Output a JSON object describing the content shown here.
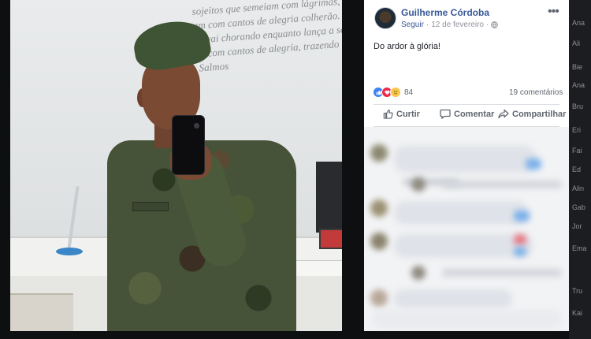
{
  "post": {
    "author": "Guilherme Córdoba",
    "follow": "Seguir",
    "separator": "·",
    "date": "12 de fevereiro",
    "menu": "•••",
    "caption": "Do ardor à glória!",
    "reaction_count": "84",
    "comments_count": "19 comentários",
    "actions": {
      "like": "Curtir",
      "comment": "Comentar",
      "share": "Compartilhar"
    }
  },
  "photo_wall_text": [
    "sojeitos que semeiam com lágrimas,",
    "am com cantos de alegria colherão.",
    "ue vai chorando enquanto lança a semente,",
    "ão com cantos de alegria, trazendo os seus feixes.",
    "Salmos"
  ],
  "side_labels": [
    "Ana",
    "Ali",
    "Bie",
    "Ana",
    "Bru",
    "Eri",
    "Fai",
    "Ed",
    "Alin",
    "Gab",
    "Jor",
    "Ema",
    "Tru",
    "Kai"
  ],
  "colors": {
    "link": "#385898",
    "like": "#3b83f5",
    "love": "#f0284a",
    "sad": "#f7c64a",
    "page_bg": "#0e0f11"
  }
}
